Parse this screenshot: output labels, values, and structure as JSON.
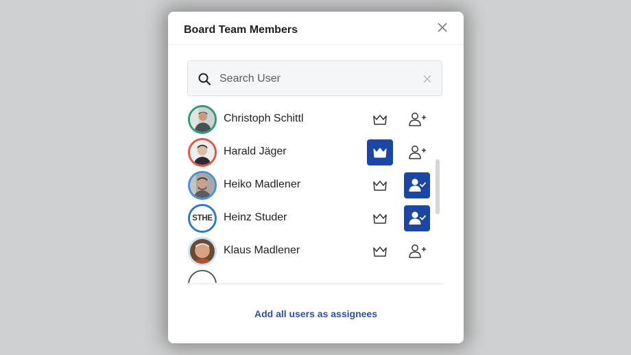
{
  "dialog": {
    "title": "Board Team Members",
    "close_icon": "close-icon"
  },
  "search": {
    "placeholder": "Search User",
    "value": "",
    "icon": "search-icon",
    "clear_icon": "clear-icon"
  },
  "colors": {
    "accent": "#1a47a3",
    "link": "#2a4fa8"
  },
  "members": [
    {
      "name": "Christoph Schittl",
      "avatar": "photo",
      "ring_color": "#2e9b72",
      "is_owner": false,
      "is_assignee": false
    },
    {
      "name": "Harald Jäger",
      "avatar": "photo",
      "ring_color": "#e0564a",
      "is_owner": true,
      "is_assignee": false
    },
    {
      "name": "Heiko Madlener",
      "avatar": "photo",
      "ring_color": "#4a90d9",
      "is_owner": false,
      "is_assignee": true
    },
    {
      "name": "Heinz Studer",
      "avatar": "initials",
      "initials": "STHE",
      "ring_color": "#2e7cc4",
      "is_owner": false,
      "is_assignee": true
    },
    {
      "name": "Klaus Madlener",
      "avatar": "photo",
      "ring_color": "#c9e2f5",
      "is_owner": false,
      "is_assignee": false
    },
    {
      "name": "",
      "avatar": "partial",
      "ring_color": "#555b66",
      "is_owner": false,
      "is_assignee": false
    }
  ],
  "footer": {
    "add_all_label": "Add all users as assignees"
  }
}
